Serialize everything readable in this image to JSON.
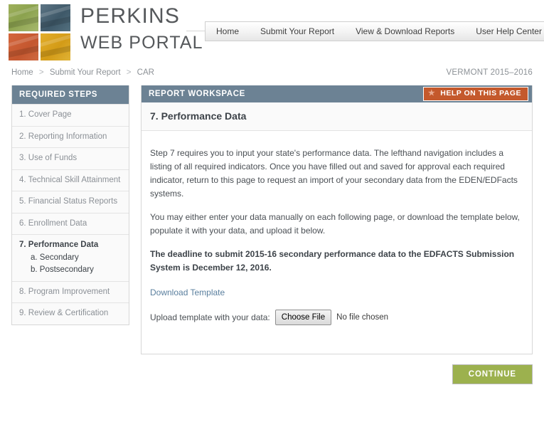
{
  "brand": {
    "line1": "PERKINS",
    "line2": "WEB PORTAL",
    "tiles": [
      {
        "name": "students-photo-tile",
        "color": "#95a957"
      },
      {
        "name": "hands-photo-tile",
        "color": "#4a6476"
      },
      {
        "name": "chart-photo-tile",
        "color": "#ca5f35"
      },
      {
        "name": "machinery-photo-tile",
        "color": "#dba520"
      }
    ]
  },
  "topnav": {
    "items": [
      {
        "label": "Home",
        "name": "nav-home"
      },
      {
        "label": "Submit Your Report",
        "name": "nav-submit-your-report"
      },
      {
        "label": "View & Download Reports",
        "name": "nav-view-download-reports"
      },
      {
        "label": "User Help Center",
        "name": "nav-user-help-center"
      }
    ]
  },
  "breadcrumb": {
    "items": [
      "Home",
      "Submit Your Report",
      "CAR"
    ],
    "separator": ">"
  },
  "state_year": "VERMONT 2015–2016",
  "sidebar": {
    "header": "REQUIRED STEPS",
    "items": [
      {
        "label": "1. Cover Page",
        "active": false
      },
      {
        "label": "2. Reporting Information",
        "active": false
      },
      {
        "label": "3. Use of Funds",
        "active": false
      },
      {
        "label": "4. Technical Skill Attainment",
        "active": false
      },
      {
        "label": "5. Financial Status Reports",
        "active": false
      },
      {
        "label": "6. Enrollment Data",
        "active": false
      },
      {
        "label": "7. Performance Data",
        "active": true,
        "subitems": [
          "a. Secondary",
          "b. Postsecondary"
        ]
      },
      {
        "label": "8. Program Improvement",
        "active": false
      },
      {
        "label": "9. Review & Certification",
        "active": false
      }
    ]
  },
  "workspace": {
    "header": "REPORT WORKSPACE",
    "help_button": "HELP ON THIS PAGE",
    "help_icon": "star-icon",
    "page_title": "7. Performance Data",
    "paragraph1": "Step 7 requires you to input your state's performance data. The lefthand navigation includes a listing of all required indicators. Once you have filled out and saved for approval each required indicator, return to this page to request an import of your secondary data from the EDEN/EDFacts systems.",
    "paragraph2": "You may either enter your data manually on each following page, or download the template below, populate it with your data, and upload it below.",
    "deadline": "The deadline to submit 2015-16 secondary performance data to the EDFACTS Submission System is December 12, 2016.",
    "download_link": "Download Template",
    "upload_label": "Upload template with your data:",
    "choose_file_button": "Choose File",
    "file_status": "No file chosen"
  },
  "footer": {
    "continue_button": "CONTINUE"
  },
  "colors": {
    "panel_header": "#6c8294",
    "help_button": "#c4592c",
    "continue_button": "#9cb14e",
    "link": "#5a7f9e"
  }
}
